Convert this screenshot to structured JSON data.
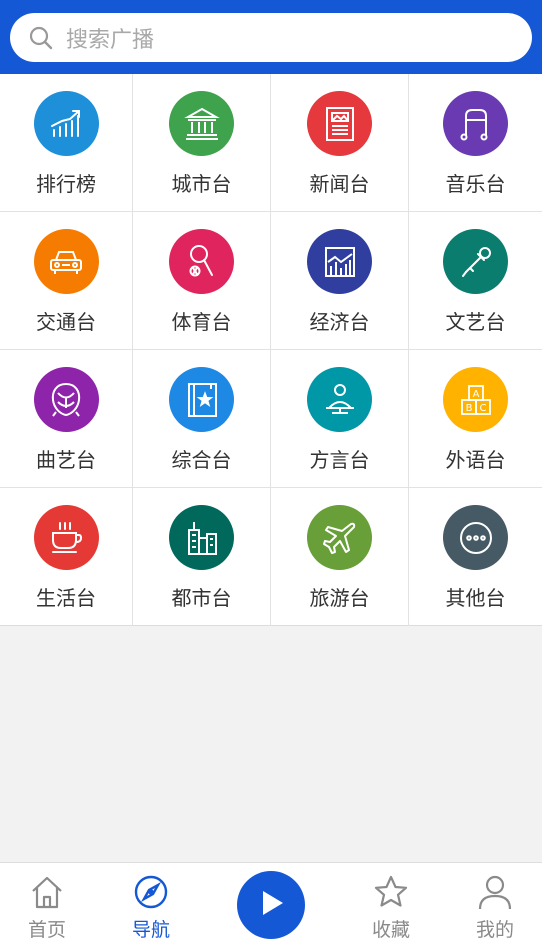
{
  "search": {
    "placeholder": "搜索广播",
    "icon": "search-icon"
  },
  "categories": [
    {
      "label": "排行榜",
      "color": "#1e8fd9",
      "icon": "chart-up-icon"
    },
    {
      "label": "城市台",
      "color": "#3fa34d",
      "icon": "government-building-icon"
    },
    {
      "label": "新闻台",
      "color": "#e5393d",
      "icon": "newspaper-icon"
    },
    {
      "label": "音乐台",
      "color": "#6a3ab2",
      "icon": "music-note-icon"
    },
    {
      "label": "交通台",
      "color": "#f57c00",
      "icon": "car-icon"
    },
    {
      "label": "体育台",
      "color": "#e0245e",
      "icon": "ping-pong-icon"
    },
    {
      "label": "经济台",
      "color": "#303f9f",
      "icon": "economy-chart-icon"
    },
    {
      "label": "文艺台",
      "color": "#0a7d6e",
      "icon": "microphone-icon"
    },
    {
      "label": "曲艺台",
      "color": "#8e24aa",
      "icon": "opera-mask-icon"
    },
    {
      "label": "综合台",
      "color": "#1e88e5",
      "icon": "star-book-icon"
    },
    {
      "label": "方言台",
      "color": "#0097a7",
      "icon": "speaker-person-icon"
    },
    {
      "label": "外语台",
      "color": "#ffb300",
      "icon": "abc-blocks-icon"
    },
    {
      "label": "生活台",
      "color": "#e53935",
      "icon": "coffee-cup-icon"
    },
    {
      "label": "都市台",
      "color": "#00695c",
      "icon": "city-buildings-icon"
    },
    {
      "label": "旅游台",
      "color": "#689f38",
      "icon": "airplane-icon"
    },
    {
      "label": "其他台",
      "color": "#455a64",
      "icon": "more-dots-icon"
    }
  ],
  "nav": {
    "home": {
      "label": "首页",
      "icon": "home-icon"
    },
    "guide": {
      "label": "导航",
      "icon": "compass-icon",
      "active": true
    },
    "play": {
      "icon": "play-icon"
    },
    "favorites": {
      "label": "收藏",
      "icon": "star-icon"
    },
    "mine": {
      "label": "我的",
      "icon": "person-icon"
    }
  },
  "colors": {
    "brand": "#1558d6",
    "inactive": "#8a8a8a"
  }
}
